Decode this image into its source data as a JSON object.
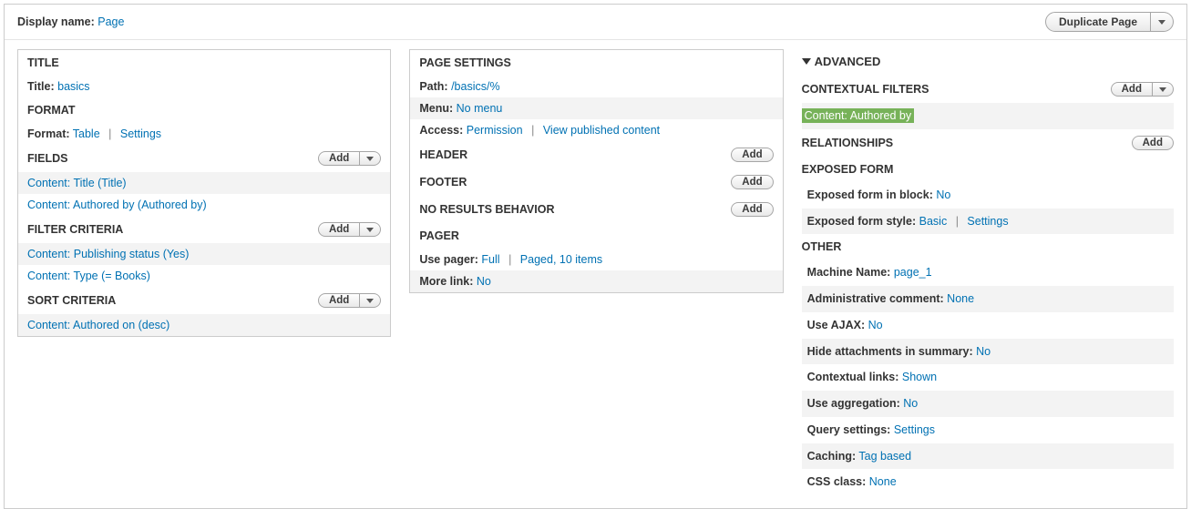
{
  "topbar": {
    "display_name_label": "Display name:",
    "display_name_value": "Page",
    "duplicate_label": "Duplicate Page"
  },
  "col1": {
    "title_heading": "TITLE",
    "title_label": "Title:",
    "title_value": "basics",
    "format_heading": "FORMAT",
    "format_label": "Format:",
    "format_value": "Table",
    "format_settings": "Settings",
    "fields_heading": "FIELDS",
    "add_label": "Add",
    "fields_items": [
      "Content: Title (Title)",
      "Content: Authored by (Authored by)"
    ],
    "filter_heading": "FILTER CRITERIA",
    "filter_items": [
      "Content: Publishing status (Yes)",
      "Content: Type (= Books)"
    ],
    "sort_heading": "SORT CRITERIA",
    "sort_items": [
      "Content: Authored on (desc)"
    ]
  },
  "col2": {
    "page_settings_heading": "PAGE SETTINGS",
    "path_label": "Path:",
    "path_value": "/basics/%",
    "menu_label": "Menu:",
    "menu_value": "No menu",
    "access_label": "Access:",
    "access_value": "Permission",
    "access_desc": "View published content",
    "header_heading": "HEADER",
    "footer_heading": "FOOTER",
    "noresults_heading": "NO RESULTS BEHAVIOR",
    "pager_heading": "PAGER",
    "use_pager_label": "Use pager:",
    "use_pager_value": "Full",
    "use_pager_desc": "Paged, 10 items",
    "more_link_label": "More link:",
    "more_link_value": "No",
    "add_label": "Add"
  },
  "col3": {
    "advanced_heading": "ADVANCED",
    "contextual_heading": "CONTEXTUAL FILTERS",
    "add_label": "Add",
    "contextual_item": "Content: Authored by",
    "relationships_heading": "RELATIONSHIPS",
    "exposed_form_heading": "EXPOSED FORM",
    "exposed_block_label": "Exposed form in block:",
    "exposed_block_value": "No",
    "exposed_style_label": "Exposed form style:",
    "exposed_style_value": "Basic",
    "exposed_style_settings": "Settings",
    "other_heading": "OTHER",
    "other": [
      {
        "label": "Machine Name:",
        "value": "page_1"
      },
      {
        "label": "Administrative comment:",
        "value": "None"
      },
      {
        "label": "Use AJAX:",
        "value": "No"
      },
      {
        "label": "Hide attachments in summary:",
        "value": "No"
      },
      {
        "label": "Contextual links:",
        "value": "Shown"
      },
      {
        "label": "Use aggregation:",
        "value": "No"
      },
      {
        "label": "Query settings:",
        "value": "Settings"
      },
      {
        "label": "Caching:",
        "value": "Tag based"
      },
      {
        "label": "CSS class:",
        "value": "None"
      }
    ]
  }
}
